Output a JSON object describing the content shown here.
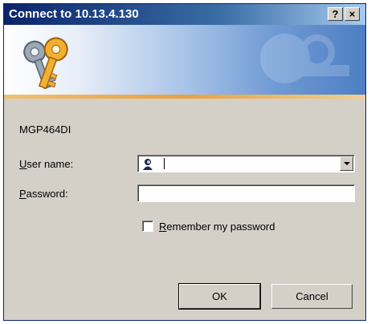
{
  "window": {
    "title": "Connect to 10.13.4.130",
    "help_label": "?",
    "close_label": "×"
  },
  "server_name": "MGP464DI",
  "form": {
    "user_label_key": "U",
    "user_label_rest": "ser name:",
    "user_value": "",
    "password_label_key": "P",
    "password_label_rest": "assword:",
    "password_value": "",
    "remember_key": "R",
    "remember_rest": "emember my password",
    "remember_checked": false
  },
  "buttons": {
    "ok_label": "OK",
    "cancel_label": "Cancel"
  },
  "colors": {
    "title_bar": "#0a246a",
    "dialog_bg": "#d4d0c8",
    "key_gold": "#e8a020"
  }
}
